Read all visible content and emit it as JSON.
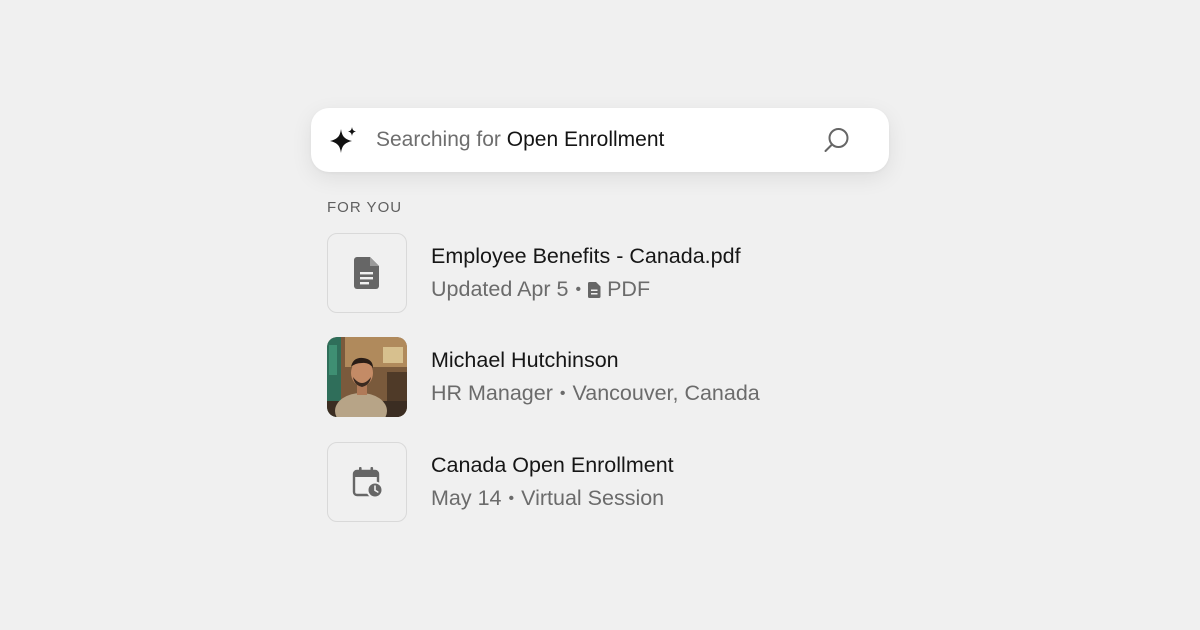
{
  "search": {
    "prefix": "Searching for",
    "query": "Open Enrollment",
    "ai_icon": "sparkle-icon",
    "search_icon": "magnifier-icon"
  },
  "section": {
    "label": "FOR YOU"
  },
  "results": [
    {
      "title": "Employee Benefits - Canada.pdf",
      "meta": "Updated Apr 5",
      "type_icon": "document-icon",
      "type": "PDF",
      "icon": "document-icon"
    },
    {
      "title": "Michael Hutchinson",
      "meta": "HR Manager",
      "location": "Vancouver, Canada",
      "icon": "avatar-photo"
    },
    {
      "title": "Canada Open Enrollment",
      "meta": "May 14",
      "detail": "Virtual Session",
      "icon": "calendar-clock-icon"
    }
  ],
  "colors": {
    "background": "#f0f0f0",
    "card": "#ffffff",
    "icon_gray": "#666666",
    "border": "#d9d9d9"
  }
}
